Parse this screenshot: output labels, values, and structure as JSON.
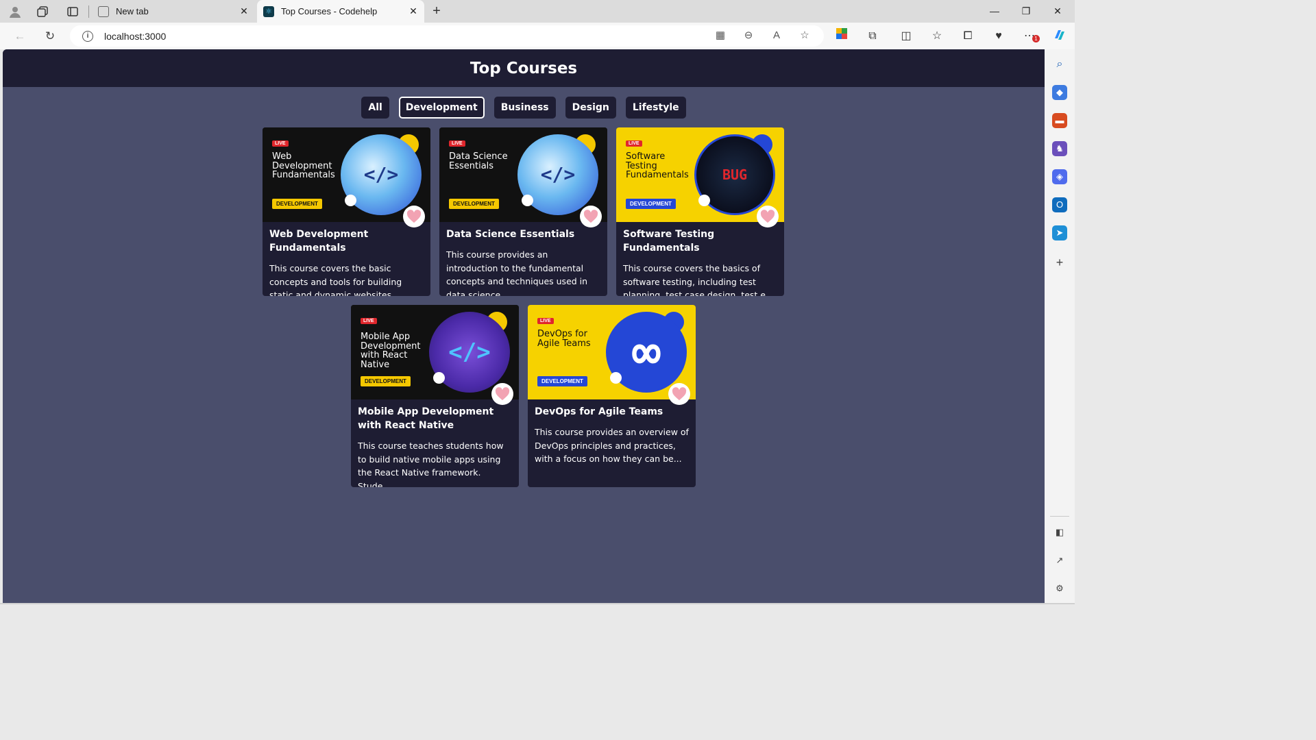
{
  "browser": {
    "tabs": [
      {
        "label": "New tab",
        "active": false
      },
      {
        "label": "Top Courses - Codehelp",
        "active": true
      }
    ],
    "address": "localhost:3000",
    "notification_count": "1"
  },
  "app": {
    "title": "Top Courses",
    "filters": [
      "All",
      "Development",
      "Business",
      "Design",
      "Lifestyle"
    ],
    "selected_filter": "Development",
    "courses": [
      {
        "title": "Web Development Fundamentals",
        "description": "This course covers the basic concepts and tools for building static and dynamic websites. Students w...",
        "thumb_title": "Web Development Fundamentals",
        "thumb_badge": "DEVELOPMENT",
        "thumb_live": "LIVE",
        "thumb_bg": "#111111",
        "thumb_color": "#ffffff",
        "thumb_glyph": "</>",
        "liked": false
      },
      {
        "title": "Data Science Essentials",
        "description": "This course provides an introduction to the fundamental concepts and techniques used in data science...",
        "thumb_title": "Data Science Essentials",
        "thumb_badge": "DEVELOPMENT",
        "thumb_live": "LIVE",
        "thumb_bg": "#111111",
        "thumb_color": "#ffffff",
        "thumb_glyph": "</>",
        "liked": false
      },
      {
        "title": "Software Testing Fundamentals",
        "description": "This course covers the basics of software testing, including test planning, test case design, test e...",
        "thumb_title": "Software Testing Fundamentals",
        "thumb_badge": "DEVELOPMENT",
        "thumb_live": "LIVE",
        "thumb_bg": "#f6d200",
        "thumb_color": "#111111",
        "thumb_glyph": "BUG",
        "liked": false
      },
      {
        "title": "Mobile App Development with React Native",
        "description": "This course teaches students how to build native mobile apps using the React Native framework. Stude...",
        "thumb_title": "Mobile App Development with React Native",
        "thumb_badge": "DEVELOPMENT",
        "thumb_live": "LIVE",
        "thumb_bg": "#111111",
        "thumb_color": "#ffffff",
        "thumb_glyph": "</>",
        "liked": false
      },
      {
        "title": "DevOps for Agile Teams",
        "description": "This course provides an overview of DevOps principles and practices, with a focus on how they can be...",
        "thumb_title": "DevOps for Agile Teams",
        "thumb_badge": "DEVELOPMENT",
        "thumb_live": "LIVE",
        "thumb_bg": "#f6d200",
        "thumb_color": "#111111",
        "thumb_glyph": "∞",
        "liked": false
      }
    ]
  },
  "colors": {
    "header_bg": "#1e1d33",
    "page_bg": "#4a4e6c",
    "like_icon": "#f2a3b3"
  }
}
